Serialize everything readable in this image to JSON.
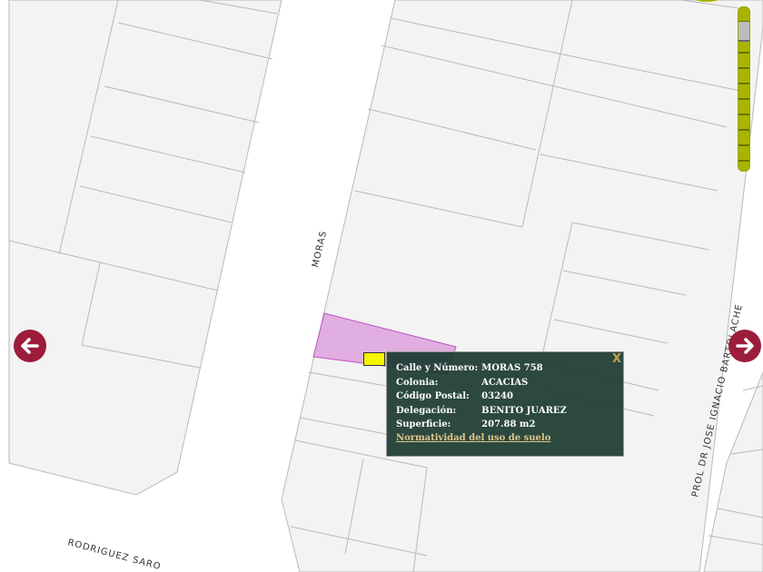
{
  "map": {
    "streets": [
      "MORAS",
      "RODRIGUEZ SARO",
      "PROL DR JOSE IGNACIO BARTOLACHE"
    ],
    "highlight_color": "#e0aee0",
    "zoom_level": 0.9
  },
  "nav": {
    "left_icon": "arrow-left-icon",
    "right_icon": "arrow-right-icon",
    "color": "#9c1c3c"
  },
  "popup": {
    "close_label": "X",
    "rows": [
      {
        "label": "Calle y Número:",
        "value": "MORAS 758"
      },
      {
        "label": "Colonia:",
        "value": "ACACIAS"
      },
      {
        "label": "Código Postal:",
        "value": "03240"
      },
      {
        "label": "Delegación:",
        "value": "BENITO JUAREZ"
      },
      {
        "label": "Superficie:",
        "value": "207.88 m2"
      }
    ],
    "link": "Normatividad del uso de suelo"
  }
}
